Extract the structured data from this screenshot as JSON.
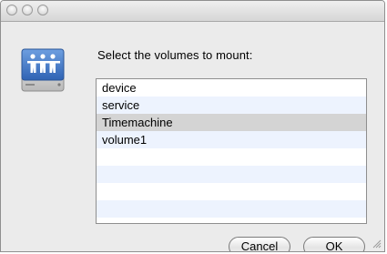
{
  "dialog": {
    "prompt": "Select the volumes to mount:",
    "volumes": [
      {
        "label": "device"
      },
      {
        "label": "service"
      },
      {
        "label": "Timemachine"
      },
      {
        "label": "volume1"
      }
    ],
    "selected": "Timemachine",
    "cancel_label": "Cancel",
    "ok_label": "OK",
    "icon": "network-server-icon",
    "colors": {
      "selected_row": "#d4d4d4",
      "alt_row": "#edf3fe",
      "icon_blue": "#3f78c9"
    }
  }
}
